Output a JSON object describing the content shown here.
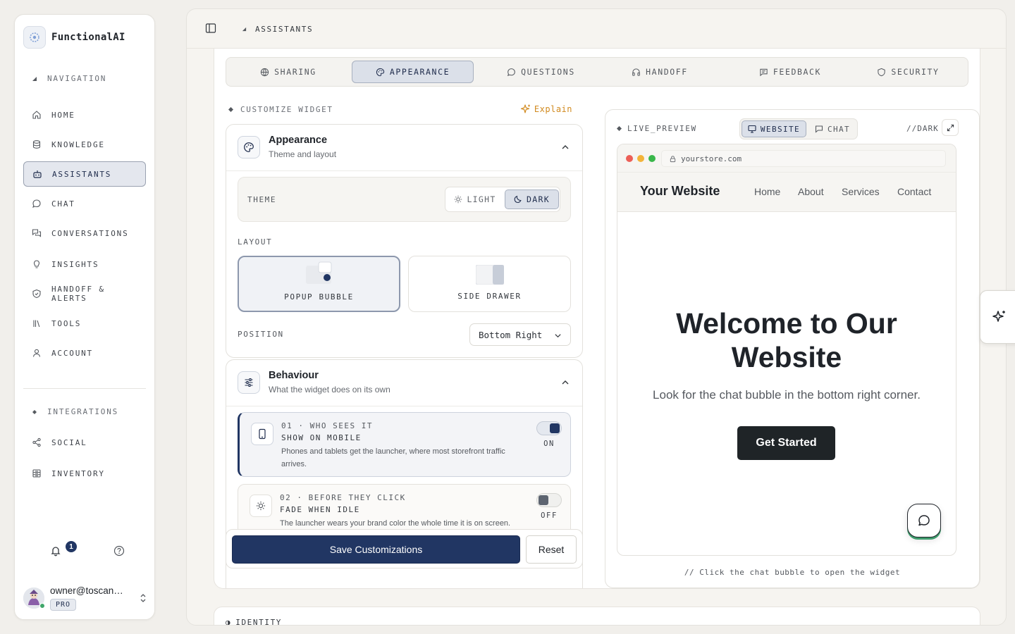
{
  "sidebar": {
    "brand": "FunctionalAI",
    "navigation_label": "NAVIGATION",
    "items": [
      {
        "label": "HOME",
        "icon": "home-icon"
      },
      {
        "label": "KNOWLEDGE",
        "icon": "database-icon"
      },
      {
        "label": "ASSISTANTS",
        "icon": "bot-icon",
        "active": true
      },
      {
        "label": "CHAT",
        "icon": "chat-icon"
      },
      {
        "label": "CONVERSATIONS",
        "icon": "conversations-icon"
      },
      {
        "label": "INSIGHTS",
        "icon": "lightbulb-icon"
      },
      {
        "label": "HANDOFF & ALERTS",
        "icon": "shield-icon"
      },
      {
        "label": "TOOLS",
        "icon": "library-icon"
      },
      {
        "label": "ACCOUNT",
        "icon": "user-icon"
      }
    ],
    "integrations_label": "INTEGRATIONS",
    "integrations": [
      {
        "label": "SOCIAL",
        "icon": "share-icon"
      },
      {
        "label": "INVENTORY",
        "icon": "inventory-icon"
      }
    ],
    "notification_count": "1",
    "user": {
      "email": "owner@toscan…",
      "plan": "PRO"
    }
  },
  "topbar": {
    "breadcrumb": "ASSISTANTS"
  },
  "tabs": [
    {
      "label": "SHARING",
      "icon": "globe-icon"
    },
    {
      "label": "APPEARANCE",
      "icon": "palette-icon",
      "active": true
    },
    {
      "label": "QUESTIONS",
      "icon": "message-circle-icon"
    },
    {
      "label": "HANDOFF",
      "icon": "headphones-icon"
    },
    {
      "label": "FEEDBACK",
      "icon": "message-square-icon"
    },
    {
      "label": "SECURITY",
      "icon": "shield-icon"
    }
  ],
  "customize": {
    "header": "CUSTOMIZE WIDGET",
    "explain": "Explain",
    "appearance": {
      "title": "Appearance",
      "subtitle": "Theme and layout",
      "theme_label": "THEME",
      "theme_options": {
        "light": "LIGHT",
        "dark": "DARK"
      },
      "theme_selected": "DARK",
      "layout_label": "LAYOUT",
      "layouts": {
        "popup": "POPUP BUBBLE",
        "drawer": "SIDE DRAWER"
      },
      "layout_selected": "POPUP BUBBLE",
      "position_label": "POSITION",
      "position_value": "Bottom Right"
    },
    "behaviour": {
      "title": "Behaviour",
      "subtitle": "What the widget does on its own",
      "rules": [
        {
          "num": "01 · WHO SEES IT",
          "title": "SHOW ON MOBILE",
          "desc": "Phones and tablets get the launcher, where most storefront traffic arrives.",
          "state": "ON"
        },
        {
          "num": "02 · BEFORE THEY CLICK",
          "title": "FADE WHEN IDLE",
          "desc": "The launcher wears your brand color the whole time it is on screen.",
          "state": "OFF"
        }
      ]
    },
    "save": "Save Customizations",
    "reset": "Reset"
  },
  "preview": {
    "label": "LIVE_PREVIEW",
    "modes": {
      "website": "WEBSITE",
      "chat": "CHAT"
    },
    "dark": "//DARK",
    "url": "yourstore.com",
    "site": {
      "logo": "Your Website",
      "links": [
        "Home",
        "About",
        "Services",
        "Contact"
      ],
      "hero_title": "Welcome to Our Website",
      "hero_sub": "Look for the chat bubble in the bottom right corner.",
      "cta": "Get Started"
    },
    "caption": "// Click the chat bubble to open the widget"
  },
  "identity": {
    "label": "IDENTITY"
  },
  "colors": {
    "accent": "#213663",
    "brand_dark": "#1f2427",
    "success": "#3f9c6d",
    "explain": "#d18a1f"
  }
}
